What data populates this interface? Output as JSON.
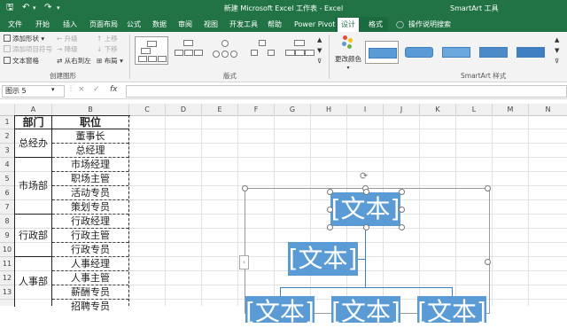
{
  "window": {
    "title": "新建 Microsoft Excel 工作表 - Excel",
    "context_tools": "SmartArt 工具"
  },
  "tabs": [
    "文件",
    "开始",
    "插入",
    "页面布局",
    "公式",
    "数据",
    "审阅",
    "视图",
    "开发工具",
    "帮助",
    "Power Pivot",
    "设计",
    "格式"
  ],
  "active_tab": "设计",
  "tell_me": "操作说明搜索",
  "ribbon": {
    "create_graphic": {
      "add_shape": "添加形状",
      "add_bullet": "添加项目符号",
      "text_pane": "文本窗格",
      "promote": "升级",
      "demote": "降级",
      "right_to_left": "从右到左",
      "move_up": "上移",
      "move_down": "下移",
      "layout": "布局",
      "label": "创建图形"
    },
    "layouts_label": "版式",
    "change_colors": "更改颜色",
    "styles_label": "SmartArt 样式"
  },
  "formula_bar": {
    "name_box": "图示 5",
    "fx": "fx",
    "cancel": "×",
    "enter": "✓"
  },
  "columns": [
    "A",
    "B",
    "C",
    "D",
    "E",
    "F",
    "G",
    "H",
    "I",
    "J",
    "K",
    "L",
    "M",
    "N"
  ],
  "rows": [
    "1",
    "2",
    "3",
    "4",
    "5",
    "6",
    "7",
    "8",
    "9",
    "10",
    "11",
    "12",
    "13"
  ],
  "sheet": {
    "col_a_header": "部门",
    "col_b_header": "职位",
    "departments": [
      "总经办",
      "市场部",
      "行政部",
      "人事部"
    ],
    "positions": [
      "董事长",
      "总经理",
      "市场经理",
      "职场主管",
      "活动专员",
      "策划专员",
      "行政经理",
      "行政主管",
      "行政专员",
      "人事经理",
      "人事主管",
      "薪酬专员",
      "招聘专员"
    ]
  },
  "smartart": {
    "top": "[文本]",
    "assistant": "[文本]",
    "bottom": [
      "[文本]",
      "[文本]",
      "[文本]"
    ]
  },
  "colors": {
    "excel_green": "#217346",
    "smartart_fill": "#5b9bd5"
  }
}
